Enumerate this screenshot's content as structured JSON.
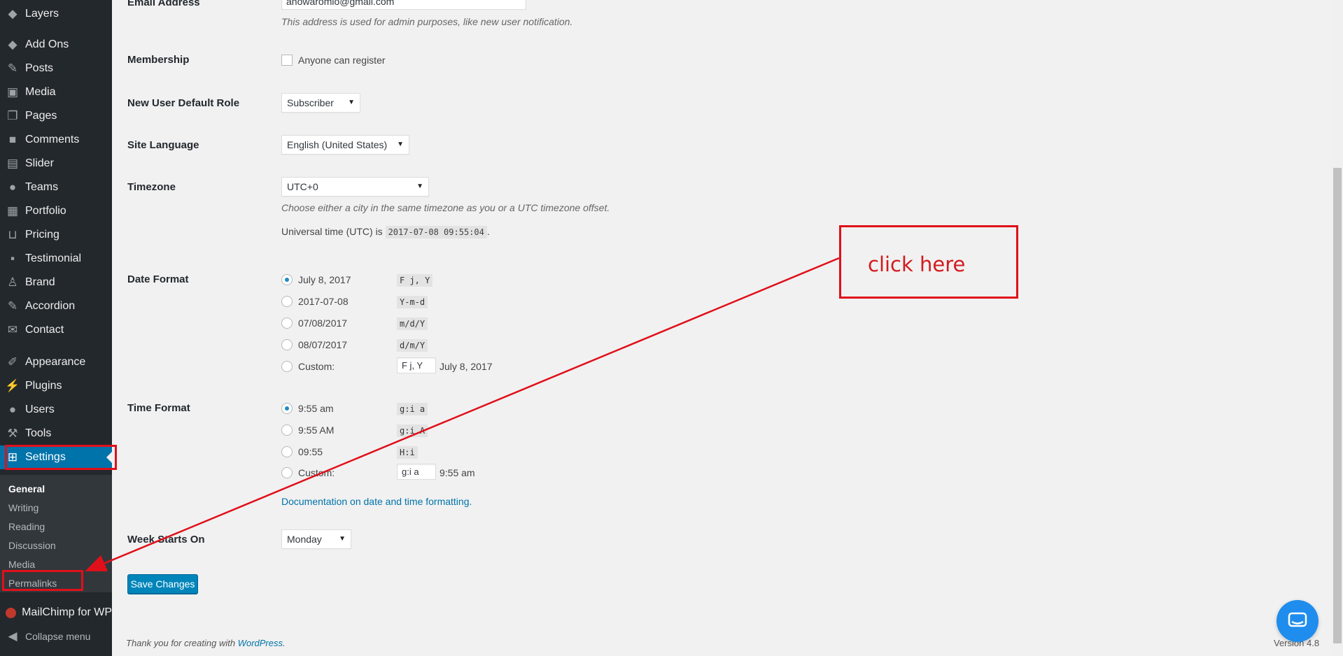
{
  "sidebar": {
    "items": [
      {
        "label": "Layers",
        "icon": "layers-icon"
      },
      {
        "label": "Add Ons",
        "icon": "layers-icon"
      },
      {
        "label": "Posts",
        "icon": "pin-icon"
      },
      {
        "label": "Media",
        "icon": "media-icon"
      },
      {
        "label": "Pages",
        "icon": "pages-icon"
      },
      {
        "label": "Comments",
        "icon": "comments-icon"
      },
      {
        "label": "Slider",
        "icon": "slider-icon"
      },
      {
        "label": "Teams",
        "icon": "user-icon"
      },
      {
        "label": "Portfolio",
        "icon": "portfolio-icon"
      },
      {
        "label": "Pricing",
        "icon": "cart-icon"
      },
      {
        "label": "Testimonial",
        "icon": "chat-icon"
      },
      {
        "label": "Brand",
        "icon": "sitemap-icon"
      },
      {
        "label": "Accordion",
        "icon": "pin-icon"
      },
      {
        "label": "Contact",
        "icon": "mail-icon"
      },
      {
        "label": "Appearance",
        "icon": "brush-icon"
      },
      {
        "label": "Plugins",
        "icon": "plug-icon"
      },
      {
        "label": "Users",
        "icon": "user-icon"
      },
      {
        "label": "Tools",
        "icon": "wrench-icon"
      },
      {
        "label": "Settings",
        "icon": "settings-icon"
      }
    ],
    "submenu": [
      "General",
      "Writing",
      "Reading",
      "Discussion",
      "Media",
      "Permalinks"
    ],
    "mailchimp": "MailChimp for WP",
    "collapse": "Collapse menu"
  },
  "form": {
    "email": {
      "label": "Email Address",
      "value": "anowaromio@gmail.com",
      "desc": "This address is used for admin purposes, like new user notification."
    },
    "membership": {
      "label": "Membership",
      "checkbox": "Anyone can register",
      "checked": false
    },
    "role": {
      "label": "New User Default Role",
      "value": "Subscriber"
    },
    "language": {
      "label": "Site Language",
      "value": "English (United States)"
    },
    "timezone": {
      "label": "Timezone",
      "value": "UTC+0",
      "desc": "Choose either a city in the same timezone as you or a UTC timezone offset.",
      "universal_prefix": "Universal time (UTC) is",
      "universal_time": "2017-07-08 09:55:04",
      "universal_suffix": "."
    },
    "date_format": {
      "label": "Date Format",
      "options": [
        {
          "label": "July 8, 2017",
          "code": "F j, Y",
          "selected": true
        },
        {
          "label": "2017-07-08",
          "code": "Y-m-d",
          "selected": false
        },
        {
          "label": "07/08/2017",
          "code": "m/d/Y",
          "selected": false
        },
        {
          "label": "08/07/2017",
          "code": "d/m/Y",
          "selected": false
        }
      ],
      "custom_label": "Custom:",
      "custom_value": "F j, Y",
      "custom_preview": "July 8, 2017"
    },
    "time_format": {
      "label": "Time Format",
      "options": [
        {
          "label": "9:55 am",
          "code": "g:i a",
          "selected": true
        },
        {
          "label": "9:55 AM",
          "code": "g:i A",
          "selected": false
        },
        {
          "label": "09:55",
          "code": "H:i",
          "selected": false
        }
      ],
      "custom_label": "Custom:",
      "custom_value": "g:i a",
      "custom_preview": "9:55 am",
      "doc_link": "Documentation on date and time formatting."
    },
    "week": {
      "label": "Week Starts On",
      "value": "Monday"
    },
    "save": "Save Changes"
  },
  "footer": {
    "thanks": "Thank you for creating with",
    "wp_link": "WordPress",
    "period": ".",
    "version": "Version 4.8"
  },
  "annotation": {
    "text": "click here",
    "color": "#e0101a"
  },
  "colors": {
    "sidebar_bg": "#23282d",
    "accent": "#0073aa",
    "submenu_bg": "#32373c"
  }
}
